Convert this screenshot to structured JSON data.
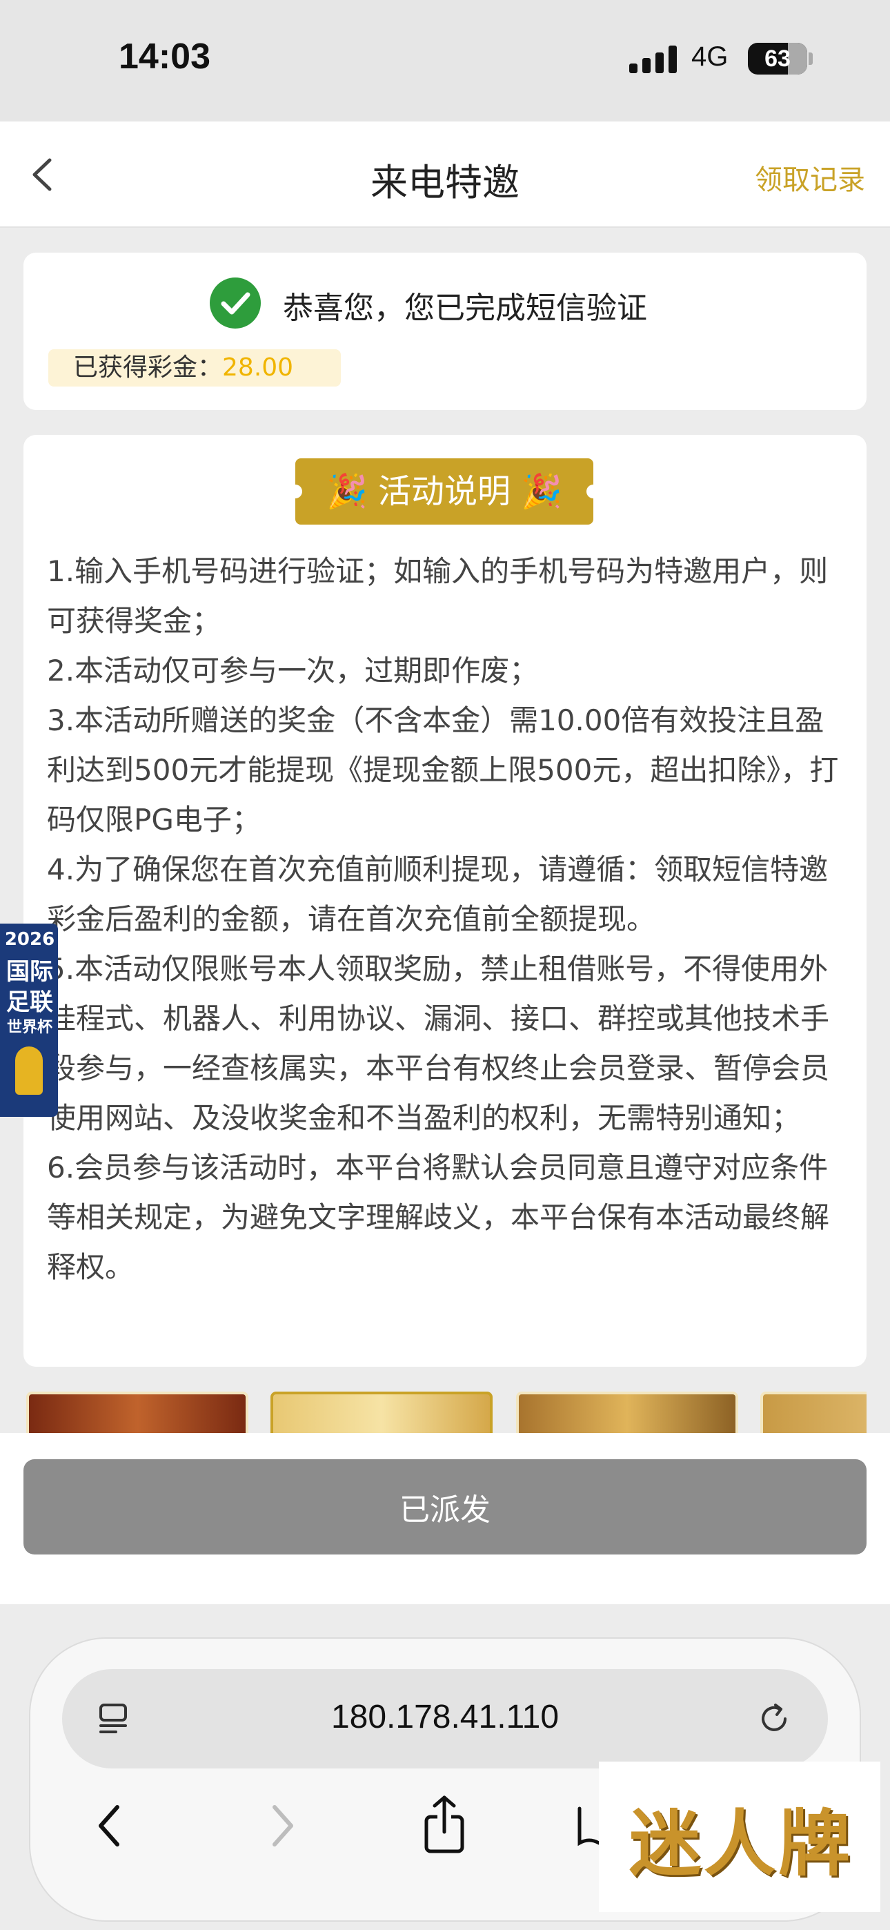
{
  "status": {
    "time": "14:03",
    "network": "4G",
    "battery": "63"
  },
  "nav": {
    "title": "来电特邀",
    "right_link": "领取记录"
  },
  "verify_card": {
    "message": "恭喜您，您已完成短信验证",
    "bonus_label": "已获得彩金：",
    "bonus_value": "28.00"
  },
  "rules_card": {
    "badge": "🎉 活动说明 🎉",
    "items": [
      "1.输入手机号码进行验证；如输入的手机号码为特邀用户，则可获得奖金；",
      "2.本活动仅可参与一次，过期即作废；",
      "3.本活动所赠送的奖金（不含本金）需10.00倍有效投注且盈利达到500元才能提现《提现金额上限500元，超出扣除》，打码仅限PG电子；",
      "4.为了确保您在首次充值前顺利提现，请遵循：领取短信特邀彩金后盈利的金额，请在首次充值前全额提现。",
      "5.本活动仅限账号本人领取奖励，禁止租借账号，不得使用外挂程式、机器人、利用协议、漏洞、接口、群控或其他技术手段参与，一经查核属实，本平台有权终止会员登录、暂停会员使用网站、及没收奖金和不当盈利的权利，无需特别通知；",
      "6.会员参与该活动时，本平台将默认会员同意且遵守对应条件等相关规定，为避免文字理解歧义，本平台保有本活动最终解释权。"
    ]
  },
  "float_ad": {
    "year": "2026",
    "line1": "国际",
    "line2": "足联",
    "line3": "世界杯"
  },
  "button": {
    "label": "已派发"
  },
  "browser": {
    "url": "180.178.41.110"
  },
  "watermark": {
    "text": "迷人牌"
  }
}
